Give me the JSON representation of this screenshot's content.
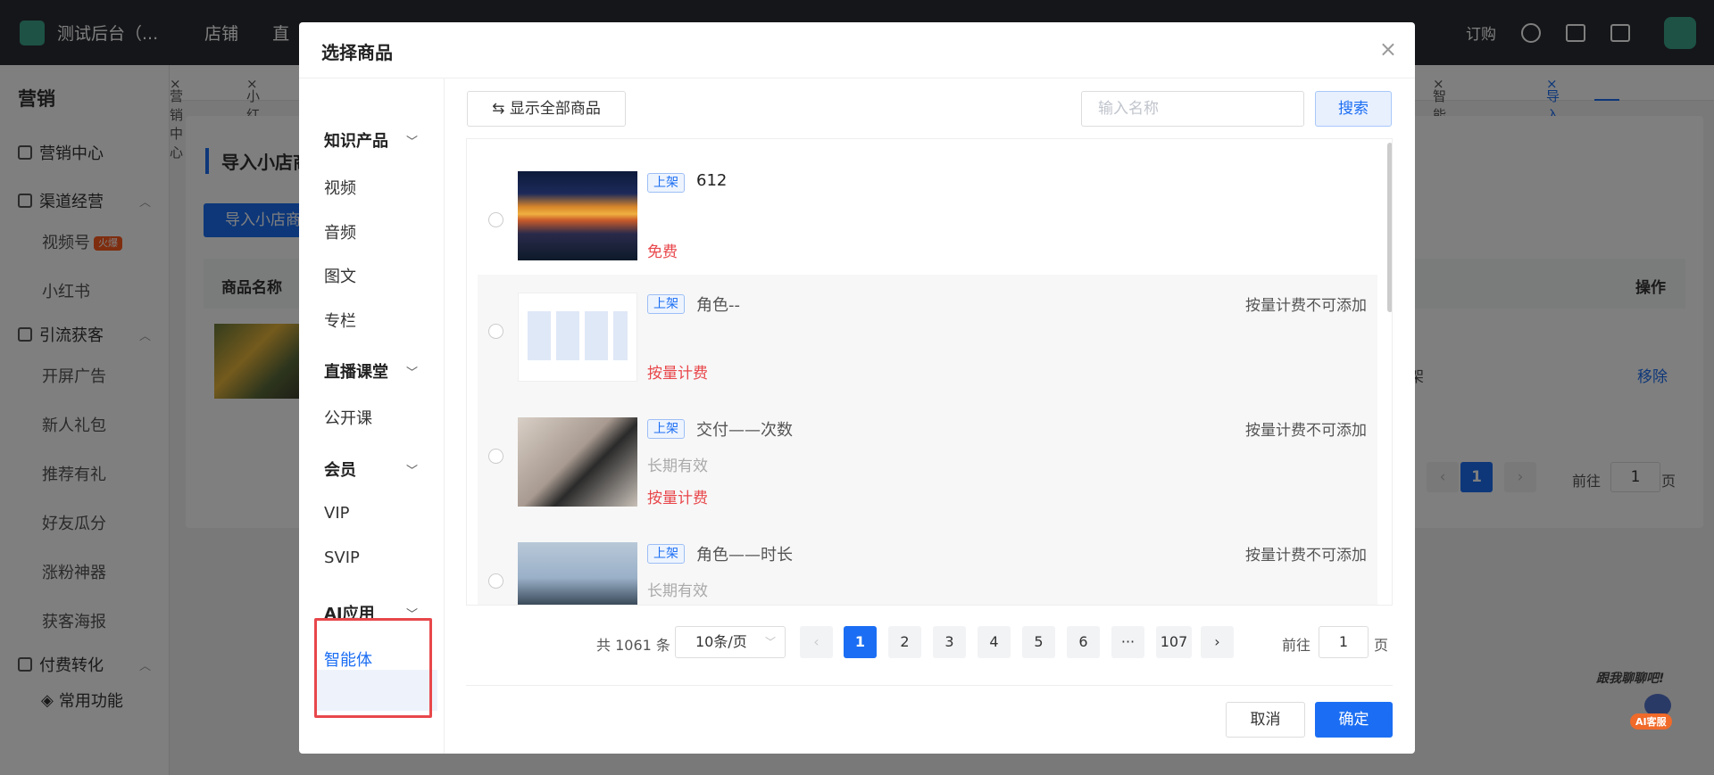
{
  "topbar": {
    "shop_name": "测试后台（...",
    "nav": [
      "店铺",
      "直"
    ],
    "order": "订购"
  },
  "sidebar": {
    "title": "营销",
    "groups": [
      {
        "label": "营销中心",
        "items": []
      },
      {
        "label": "渠道经营",
        "items": [
          "视频号",
          "小红书"
        ],
        "hot_badge": "火爆"
      },
      {
        "label": "引流获客",
        "items": [
          "开屏广告",
          "新人礼包",
          "推荐有礼",
          "好友瓜分",
          "涨粉神器",
          "获客海报"
        ]
      },
      {
        "label": "付费转化",
        "items": []
      },
      {
        "label": "常用功能",
        "items": []
      }
    ]
  },
  "tabs": {
    "left": [
      "营销中心",
      "小红书"
    ],
    "right": [
      "智能体详情",
      "导入小红书小店商品"
    ]
  },
  "page": {
    "title": "导入小店商品",
    "import_button": "导入小店商",
    "col_name": "商品名称",
    "col_op": "操作",
    "row_status_tail": "架",
    "remove": "移除",
    "page_current": "1",
    "goto": "前往",
    "goto_value": "1",
    "page_unit": "页"
  },
  "modal": {
    "title": "选择商品",
    "close": "×",
    "categories": [
      {
        "group": "知识产品",
        "items": [
          "视频",
          "音频",
          "图文",
          "专栏"
        ]
      },
      {
        "group": "直播课堂",
        "items": [
          "公开课"
        ]
      },
      {
        "group": "会员",
        "items": [
          "VIP",
          "SVIP"
        ]
      },
      {
        "group": "AI应用",
        "items": [
          "智能体"
        ]
      }
    ],
    "selected_category": "智能体",
    "show_all": "⇆ 显示全部商品",
    "search_placeholder": "输入名称",
    "search_button": "搜索",
    "products": [
      {
        "tag": "上架",
        "name": "612",
        "price": "免费",
        "note": "",
        "sub": ""
      },
      {
        "tag": "上架",
        "name": "角色--",
        "price": "按量计费",
        "note": "按量计费不可添加",
        "sub": ""
      },
      {
        "tag": "上架",
        "name": "交付——次数",
        "price": "按量计费",
        "note": "按量计费不可添加",
        "sub": "长期有效"
      },
      {
        "tag": "上架",
        "name": "角色——时长",
        "price": "",
        "note": "按量计费不可添加",
        "sub": "长期有效"
      }
    ],
    "pager": {
      "total": "共 1061 条",
      "page_size": "10条/页",
      "pages": [
        "1",
        "2",
        "3",
        "4",
        "5",
        "6",
        "···",
        "107"
      ],
      "current": "1",
      "prev": "‹",
      "next": "›",
      "goto": "前往",
      "goto_value": "1",
      "page_unit": "页"
    },
    "cancel": "取消",
    "confirm": "确定"
  },
  "ai_service": {
    "hint": "跟我聊聊吧!",
    "label": "AI客服"
  }
}
